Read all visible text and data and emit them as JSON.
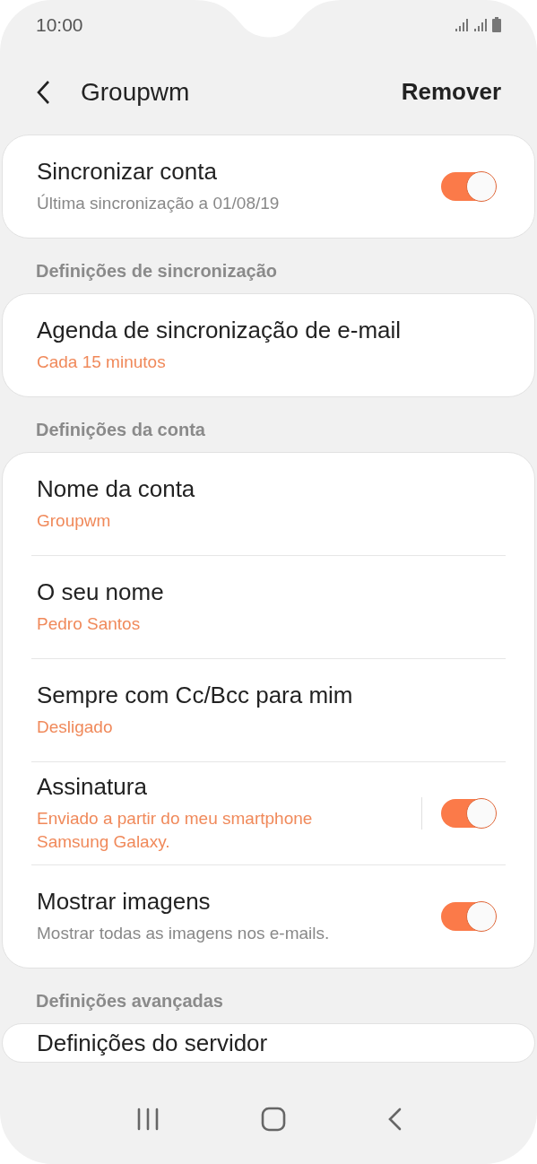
{
  "status_bar": {
    "time": "10:00"
  },
  "header": {
    "title": "Groupwm",
    "action": "Remover"
  },
  "sections": [
    {
      "items": [
        {
          "kind": "toggle",
          "title": "Sincronizar conta",
          "subtitle": "Última sincronização a 01/08/19",
          "accent": false,
          "on": true,
          "split": false
        }
      ]
    },
    {
      "header": "Definições de sincronização",
      "items": [
        {
          "kind": "text",
          "title": "Agenda de sincronização de e-mail",
          "subtitle": "Cada 15 minutos",
          "accent": true
        }
      ]
    },
    {
      "header": "Definições da conta",
      "items": [
        {
          "kind": "text",
          "title": "Nome da conta",
          "subtitle": "Groupwm",
          "accent": true
        },
        {
          "kind": "text",
          "title": "O seu nome",
          "subtitle": "Pedro Santos",
          "accent": true
        },
        {
          "kind": "text",
          "title": "Sempre com Cc/Bcc para mim",
          "subtitle": "Desligado",
          "accent": true
        },
        {
          "kind": "toggle",
          "title": "Assinatura",
          "subtitle": "Enviado a partir do meu smartphone Samsung Galaxy.",
          "accent": true,
          "on": true,
          "split": true
        },
        {
          "kind": "toggle",
          "title": "Mostrar imagens",
          "subtitle": "Mostrar todas as imagens nos e-mails.",
          "accent": false,
          "on": true,
          "split": false
        }
      ]
    },
    {
      "header": "Definições avançadas",
      "items": [
        {
          "kind": "text",
          "title": "Definições do servidor"
        }
      ]
    }
  ]
}
